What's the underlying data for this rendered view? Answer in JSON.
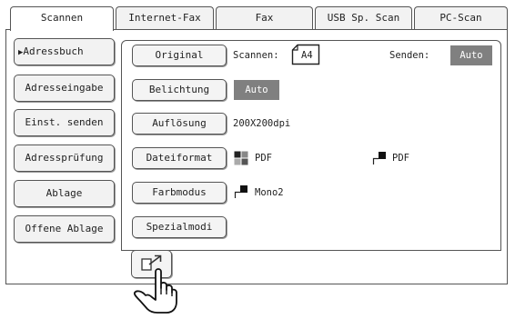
{
  "tabs": [
    {
      "label": "Scannen"
    },
    {
      "label": "Internet-Fax"
    },
    {
      "label": "Fax"
    },
    {
      "label": "USB Sp. Scan"
    },
    {
      "label": "PC-Scan"
    }
  ],
  "sidebar": {
    "items": [
      {
        "label": "Adressbuch"
      },
      {
        "label": "Adresseingabe"
      },
      {
        "label": "Einst. senden"
      },
      {
        "label": "Adressprüfung"
      },
      {
        "label": "Ablage"
      },
      {
        "label": "Offene Ablage"
      }
    ],
    "active_marker": "▶"
  },
  "settings": {
    "original": {
      "button": "Original",
      "scan_label": "Scannen:",
      "paper": "A4",
      "send_label": "Senden:",
      "send_value": "Auto"
    },
    "belichtung": {
      "button": "Belichtung",
      "value": "Auto"
    },
    "aufloesung": {
      "button": "Auflösung",
      "value": "200X200dpi"
    },
    "dateiformat": {
      "button": "Dateiformat",
      "color_format": "PDF",
      "mono_format": "PDF"
    },
    "farbmodus": {
      "button": "Farbmodus",
      "value": "Mono2"
    },
    "spezialmodi": {
      "button": "Spezialmodi"
    }
  },
  "icons": {
    "paper": "paper-orientation-icon",
    "color": "color-mode-icon",
    "mono": "mono-mode-icon",
    "export": "export-icon",
    "hand": "pointing-hand-icon"
  },
  "colors": {
    "gray_value": "#808080",
    "border": "#555555"
  }
}
